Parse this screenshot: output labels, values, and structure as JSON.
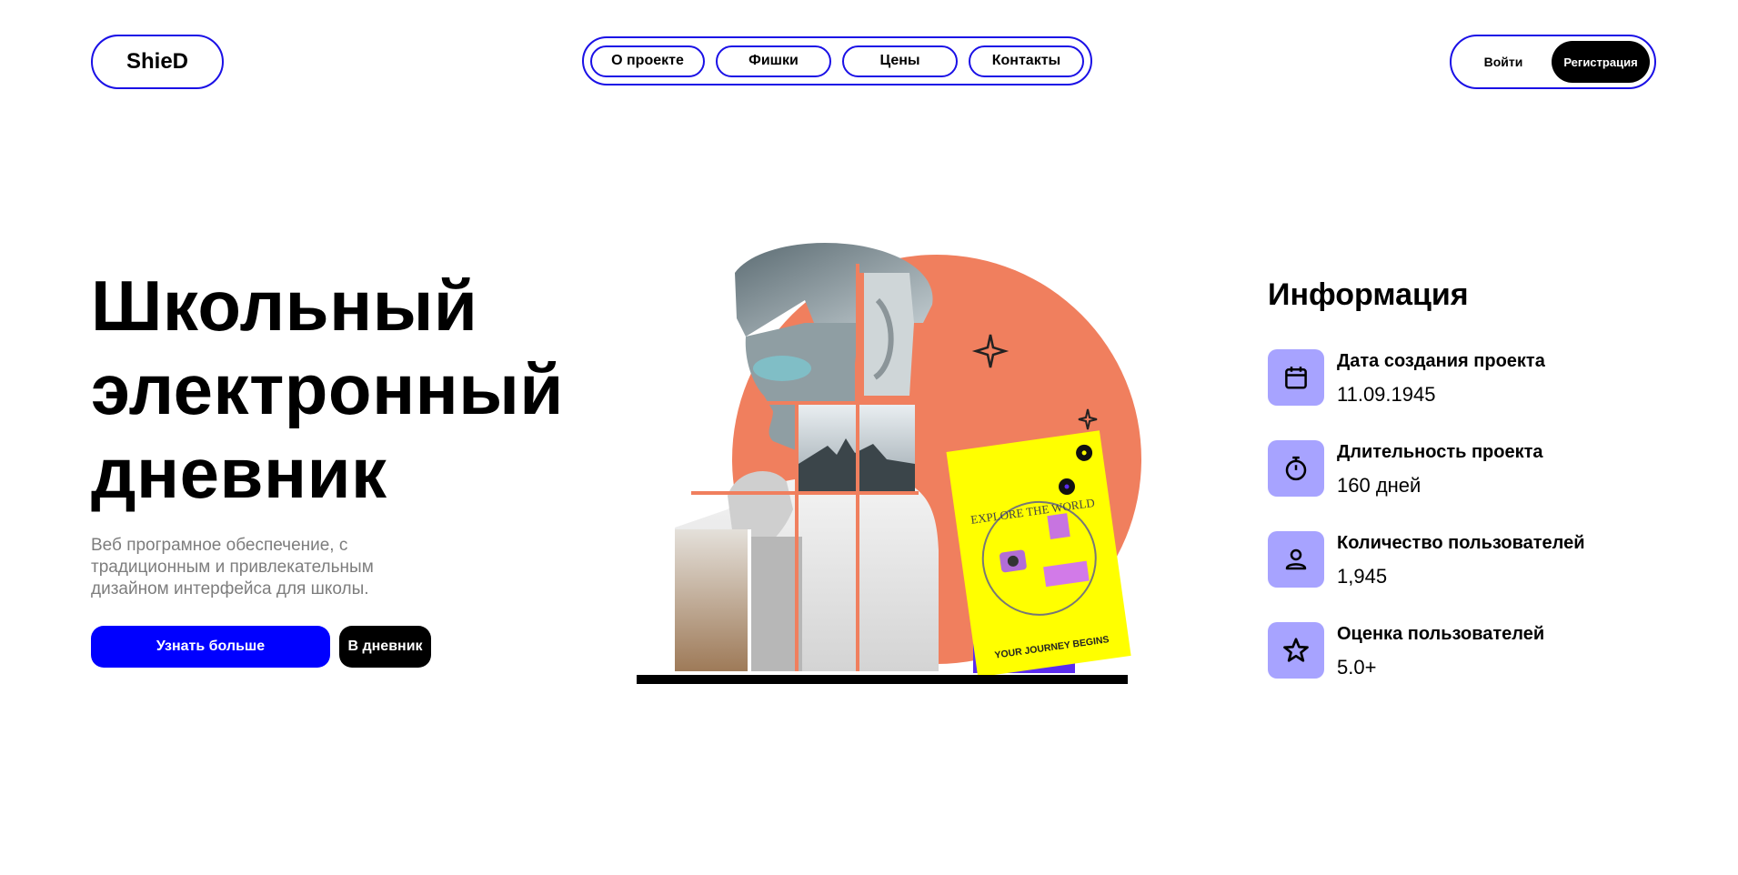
{
  "header": {
    "logo": "ShieD",
    "nav": [
      "О проекте",
      "Фишки",
      "Цены",
      "Контакты"
    ],
    "login_label": "Войти",
    "register_label": "Регистрация"
  },
  "hero": {
    "title_lines": [
      "Школьный",
      "электронный",
      "дневник"
    ],
    "subtitle": "Веб програмное обеспечение, с традиционным и привлекательным дизайном интерфейса для школы.",
    "learn_more_label": "Узнать больше",
    "diary_label": "В дневник"
  },
  "illustration": {
    "book_title": "EXPLORE THE WORLD",
    "book_caption": "YOUR JOURNEY BEGINS",
    "colors": {
      "circle": "#f07f5e",
      "book": "#ffff00",
      "book_back": "#5a2cf0"
    }
  },
  "info": {
    "title": "Информация",
    "items": [
      {
        "icon": "calendar-icon",
        "label": "Дата создания проекта",
        "value": "11.09.1945"
      },
      {
        "icon": "stopwatch-icon",
        "label": "Длительность проекта",
        "value": "160 дней"
      },
      {
        "icon": "user-icon",
        "label": "Количество пользователей",
        "value": "1,945"
      },
      {
        "icon": "star-icon",
        "label": "Оценка пользователей",
        "value": "5.0+"
      }
    ]
  },
  "colors": {
    "accent_blue": "#1a10e6",
    "primary_button": "#0000ff",
    "icon_tile": "#a7a3ff"
  }
}
